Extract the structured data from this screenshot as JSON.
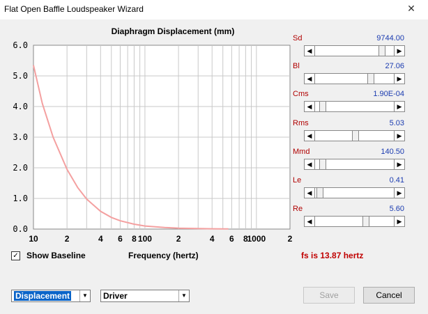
{
  "window": {
    "title": "Flat Open Baffle Loudspeaker Wizard",
    "close_glyph": "✕"
  },
  "chart_data": {
    "type": "line",
    "title": "Diaphragm Displacement (mm)",
    "xlabel": "Frequency (hertz)",
    "ylabel": "",
    "xscale": "log",
    "xlim": [
      10,
      2000
    ],
    "ylim": [
      0,
      6
    ],
    "grid": true,
    "y_ticks": [
      "0.0",
      "1.0",
      "2.0",
      "3.0",
      "4.0",
      "5.0",
      "6.0"
    ],
    "x_ticks": [
      {
        "x": 10,
        "label": "10"
      },
      {
        "x": 20,
        "label": "2"
      },
      {
        "x": 40,
        "label": "4"
      },
      {
        "x": 60,
        "label": "6"
      },
      {
        "x": 80,
        "label": "8"
      },
      {
        "x": 100,
        "label": "100"
      },
      {
        "x": 200,
        "label": "2"
      },
      {
        "x": 400,
        "label": "4"
      },
      {
        "x": 600,
        "label": "6"
      },
      {
        "x": 800,
        "label": "8"
      },
      {
        "x": 1000,
        "label": "1000"
      },
      {
        "x": 2000,
        "label": "2"
      }
    ],
    "series": [
      {
        "color": "#f4a0a0",
        "x": [
          10,
          12,
          15,
          20,
          25,
          30,
          40,
          50,
          60,
          80,
          100,
          150,
          200,
          300,
          400,
          500,
          560
        ],
        "y": [
          5.35,
          4.1,
          3.0,
          1.95,
          1.35,
          0.98,
          0.58,
          0.38,
          0.27,
          0.16,
          0.1,
          0.05,
          0.03,
          0.015,
          0.01,
          0.006,
          0.005
        ]
      }
    ]
  },
  "params": [
    {
      "name": "Sd",
      "value": "9744.00",
      "level": 0.88
    },
    {
      "name": "Bl",
      "value": "27.06",
      "level": 0.72
    },
    {
      "name": "Cms",
      "value": "1.90E-04",
      "level": 0.07
    },
    {
      "name": "Rms",
      "value": "5.03",
      "level": 0.51
    },
    {
      "name": "Mmd",
      "value": "140.50",
      "level": 0.07
    },
    {
      "name": "Le",
      "value": "0.41",
      "level": 0.03
    },
    {
      "name": "Re",
      "value": "5.60",
      "level": 0.66
    }
  ],
  "show_baseline": {
    "label": "Show Baseline",
    "checked": true,
    "check_glyph": "✓"
  },
  "freq_label": "Frequency (hertz)",
  "fs_text": "fs is 13.87 hertz",
  "combo1": {
    "value": "Displacement"
  },
  "combo2": {
    "value": "Driver"
  },
  "buttons": {
    "save": "Save",
    "cancel": "Cancel"
  },
  "arrow_glyphs": {
    "left": "◀",
    "right": "▶",
    "down": "▼"
  }
}
